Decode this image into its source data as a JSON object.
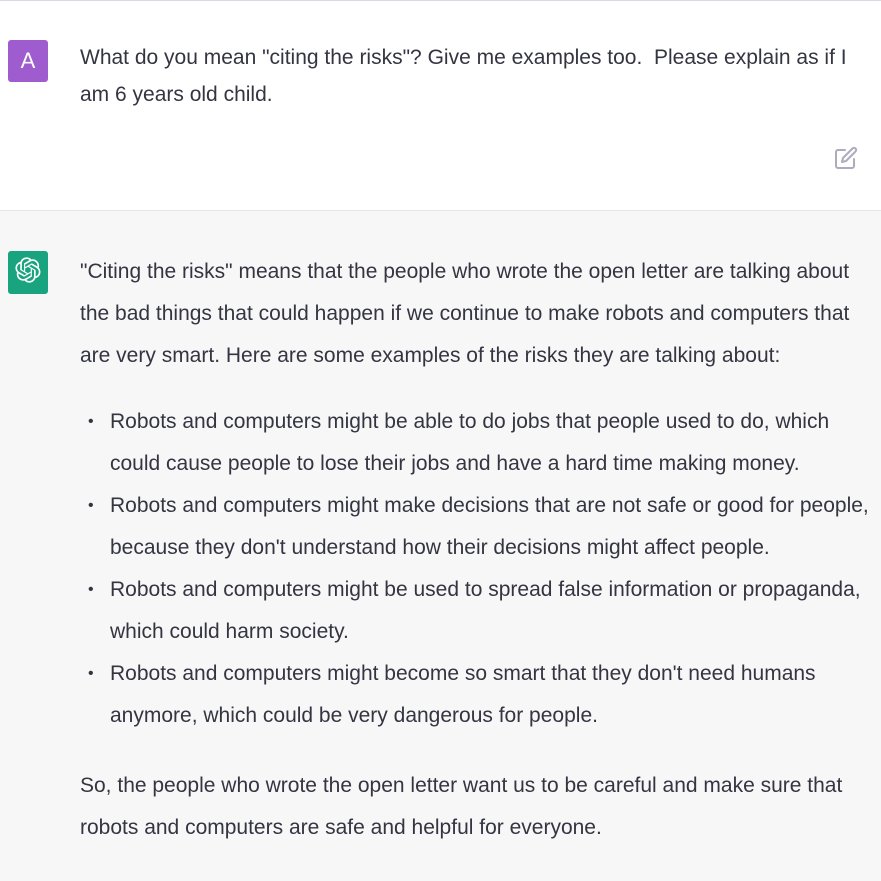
{
  "user": {
    "avatar_letter": "A",
    "message": "What do you mean \"citing the risks\"? Give me examples too.  Please explain as if I am 6 years old child."
  },
  "assistant": {
    "intro": "\"Citing the risks\" means that the people who wrote the open letter are talking about the bad things that could happen if we continue to make robots and computers that are very smart. Here are some examples of the risks they are talking about:",
    "bullets": [
      "Robots and computers might be able to do jobs that people used to do, which could cause people to lose their jobs and have a hard time making money.",
      "Robots and computers might make decisions that are not safe or good for people, because they don't understand how their decisions might affect people.",
      "Robots and computers might be used to spread false information or propaganda, which could harm society.",
      "Robots and computers might become so smart that they don't need humans anymore, which could be very dangerous for people."
    ],
    "conclusion": "So, the people who wrote the open letter want us to be careful and make sure that robots and computers are safe and helpful for everyone."
  },
  "icons": {
    "edit": "edit-icon",
    "assistant_logo": "openai-logo-icon"
  },
  "colors": {
    "user_avatar_bg": "#9e5ccf",
    "assistant_avatar_bg": "#19a37f",
    "assistant_bg": "#f7f7f8",
    "text": "#343541"
  }
}
